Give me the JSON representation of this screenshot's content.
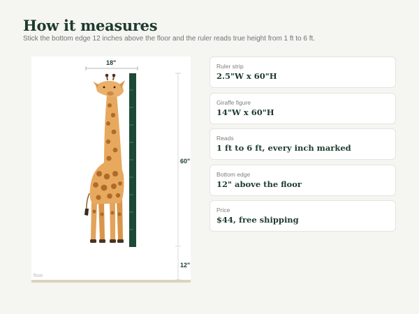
{
  "header": {
    "title": "How it measures",
    "subtitle": "Stick the bottom edge 12 inches above the floor and the ruler reads true height from 1 ft to 6 ft."
  },
  "figure": {
    "width_label": "18\"",
    "height_label": "60\"",
    "offset_label": "12\"",
    "floor_label": "floor",
    "ruler_color": "#1d4a37",
    "floor_color": "#dcd3bd"
  },
  "specs": [
    {
      "label": "Ruler strip",
      "value": "2.5\"W x 60\"H"
    },
    {
      "label": "Giraffe figure",
      "value": "14\"W x 60\"H"
    },
    {
      "label": "Reads",
      "value": "1 ft to 6 ft, every inch marked"
    },
    {
      "label": "Bottom edge",
      "value": "12\" above the floor"
    },
    {
      "label": "Price",
      "value": "$44, free shipping"
    }
  ]
}
